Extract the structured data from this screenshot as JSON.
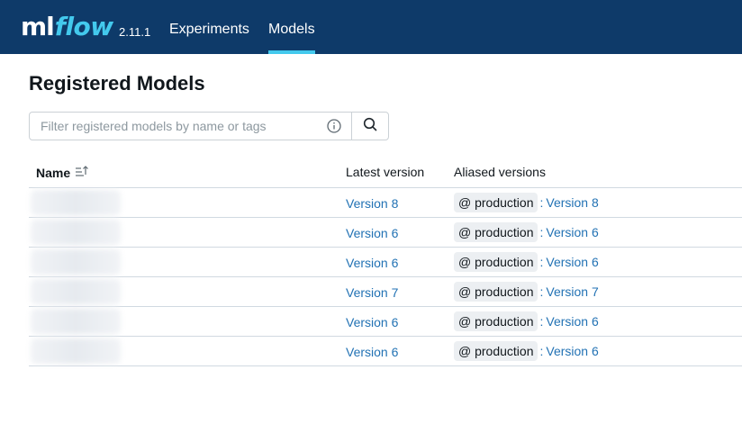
{
  "header": {
    "logo_ml": "ml",
    "logo_flow": "flow",
    "version": "2.11.1",
    "nav": [
      {
        "label": "Experiments",
        "active": false
      },
      {
        "label": "Models",
        "active": true
      }
    ],
    "colors": {
      "background": "#0e3a69",
      "accent": "#43c9ed"
    }
  },
  "page": {
    "title": "Registered Models"
  },
  "search": {
    "placeholder": "Filter registered models by name or tags",
    "value": "",
    "info_icon": "info-icon",
    "button_icon": "search-icon"
  },
  "table": {
    "columns": {
      "name": "Name",
      "name_sort_icon": "sort-ascending-icon",
      "latest": "Latest version",
      "alias": "Aliased versions"
    },
    "rows": [
      {
        "name": "",
        "latest": "Version 8",
        "alias": "@ production",
        "alias_version": "Version 8"
      },
      {
        "name": "",
        "latest": "Version 6",
        "alias": "@ production",
        "alias_version": "Version 6"
      },
      {
        "name": "",
        "latest": "Version 6",
        "alias": "@ production",
        "alias_version": "Version 6"
      },
      {
        "name": "",
        "latest": "Version 7",
        "alias": "@ production",
        "alias_version": "Version 7"
      },
      {
        "name": "",
        "latest": "Version 6",
        "alias": "@ production",
        "alias_version": "Version 6"
      },
      {
        "name": "",
        "latest": "Version 6",
        "alias": "@ production",
        "alias_version": "Version 6"
      }
    ]
  }
}
